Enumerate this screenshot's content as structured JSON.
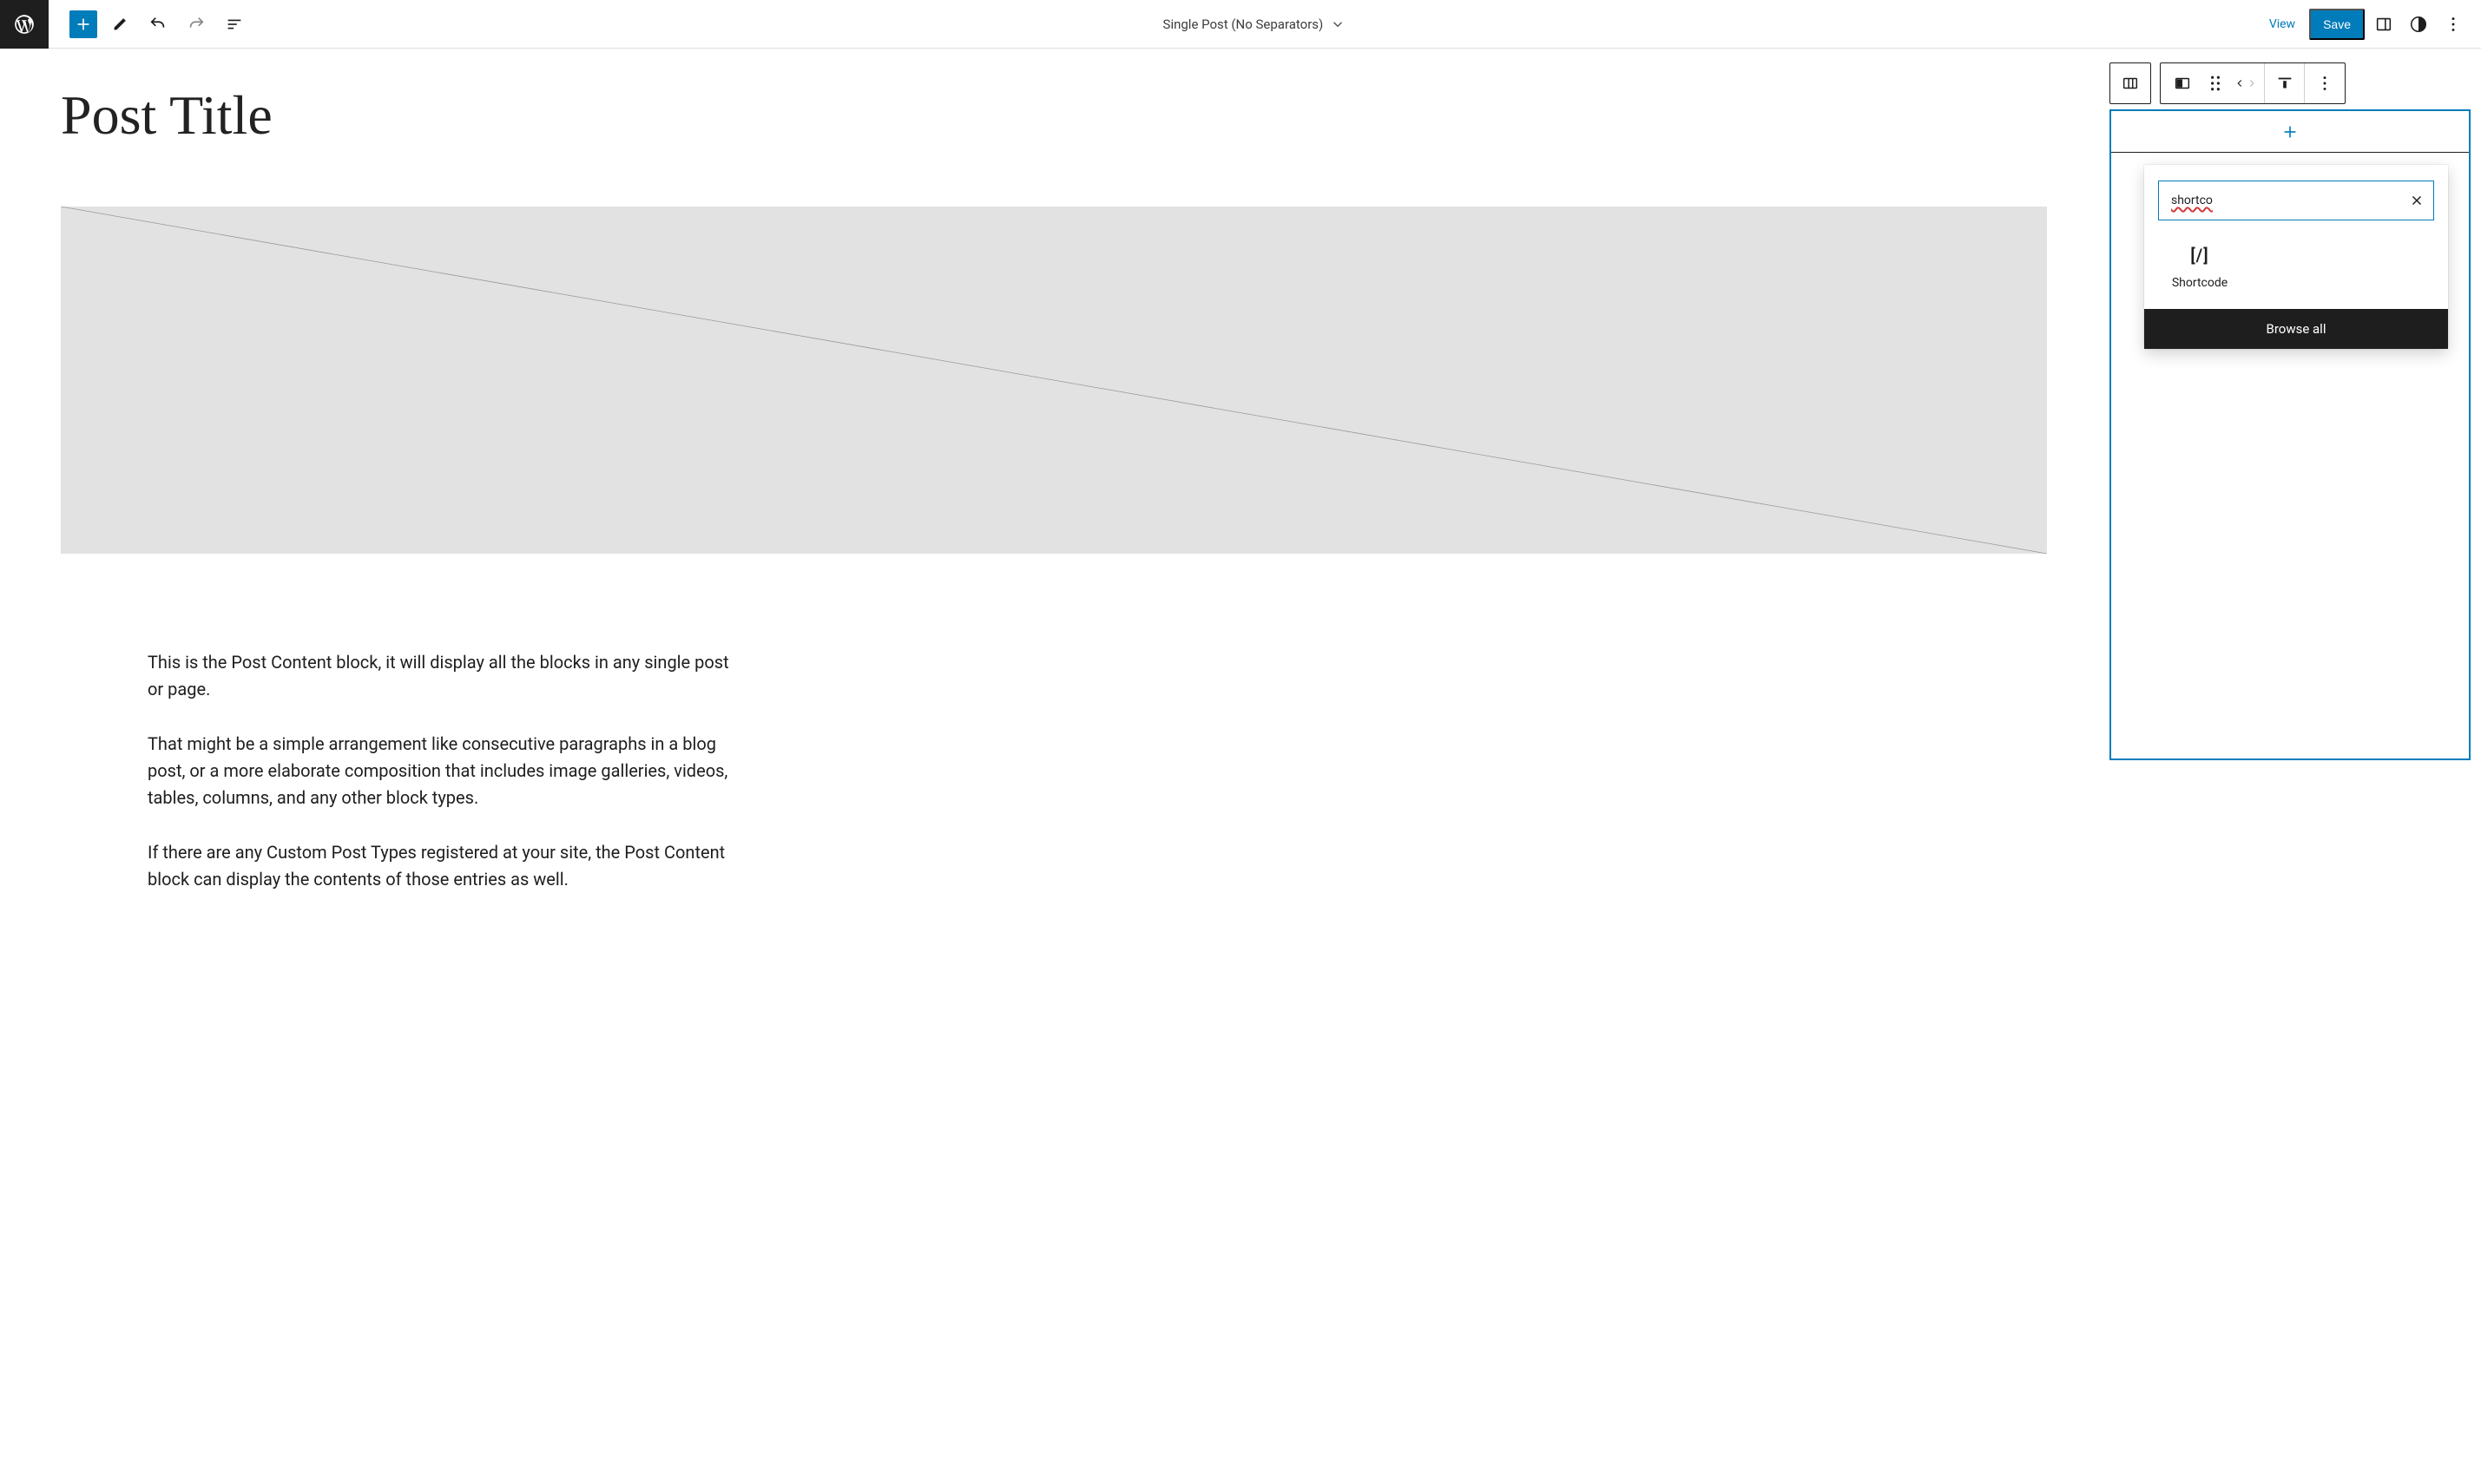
{
  "topbar": {
    "template_label": "Single Post (No Separators)",
    "view_label": "View",
    "save_label": "Save"
  },
  "canvas": {
    "post_title": "Post Title",
    "paragraphs": [
      "This is the Post Content block, it will display all the blocks in any single post or page.",
      "That might be a simple arrangement like consecutive paragraphs in a blog post, or a more elaborate composition that includes image galleries, videos, tables, columns, and any other block types.",
      "If there are any Custom Post Types registered at your site, the Post Content block can display the contents of those entries as well."
    ]
  },
  "inserter": {
    "search_value": "shortco",
    "results": [
      {
        "glyph": "[/]",
        "label": "Shortcode",
        "name": "shortcode"
      }
    ],
    "browse_all_label": "Browse all"
  },
  "colors": {
    "primary": "#007cba",
    "text": "#1e1e1e"
  }
}
